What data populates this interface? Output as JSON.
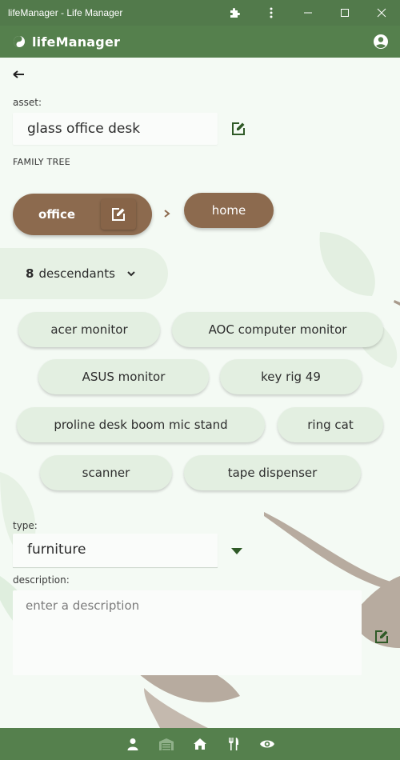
{
  "window": {
    "title": "lifeManager - Life Manager"
  },
  "app": {
    "name": "lifeManager"
  },
  "asset": {
    "label": "asset:",
    "value": "glass office desk"
  },
  "family_tree": {
    "heading": "FAMILY TREE",
    "current": "office",
    "parent": "home"
  },
  "descendants": {
    "count": "8",
    "label": "descendants",
    "items": [
      "acer monitor",
      "AOC computer monitor",
      "ASUS monitor",
      "key rig 49",
      "proline desk boom mic stand",
      "ring cat",
      "scanner",
      "tape dispenser"
    ]
  },
  "type": {
    "label": "type:",
    "value": "furniture"
  },
  "description": {
    "label": "description:",
    "placeholder": "enter a description"
  },
  "colors": {
    "primary": "#55804d",
    "node": "#8c6a4e",
    "chip": "#e3efe1",
    "background": "#f4faf4"
  },
  "bottom_nav": [
    "person-icon",
    "warehouse-icon",
    "home-icon",
    "utensils-icon",
    "eye-icon"
  ]
}
